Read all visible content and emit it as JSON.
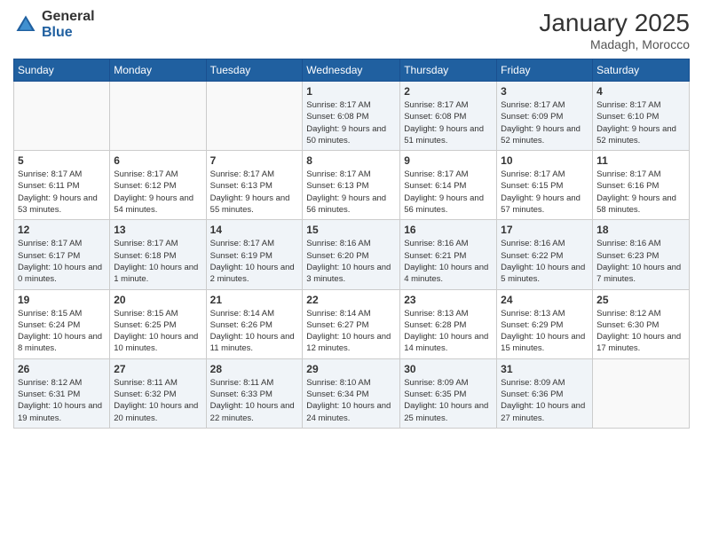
{
  "header": {
    "logo_general": "General",
    "logo_blue": "Blue",
    "month_year": "January 2025",
    "location": "Madagh, Morocco"
  },
  "days_of_week": [
    "Sunday",
    "Monday",
    "Tuesday",
    "Wednesday",
    "Thursday",
    "Friday",
    "Saturday"
  ],
  "weeks": [
    [
      {
        "day": "",
        "sunrise": "",
        "sunset": "",
        "daylight": ""
      },
      {
        "day": "",
        "sunrise": "",
        "sunset": "",
        "daylight": ""
      },
      {
        "day": "",
        "sunrise": "",
        "sunset": "",
        "daylight": ""
      },
      {
        "day": "1",
        "sunrise": "Sunrise: 8:17 AM",
        "sunset": "Sunset: 6:08 PM",
        "daylight": "Daylight: 9 hours and 50 minutes."
      },
      {
        "day": "2",
        "sunrise": "Sunrise: 8:17 AM",
        "sunset": "Sunset: 6:08 PM",
        "daylight": "Daylight: 9 hours and 51 minutes."
      },
      {
        "day": "3",
        "sunrise": "Sunrise: 8:17 AM",
        "sunset": "Sunset: 6:09 PM",
        "daylight": "Daylight: 9 hours and 52 minutes."
      },
      {
        "day": "4",
        "sunrise": "Sunrise: 8:17 AM",
        "sunset": "Sunset: 6:10 PM",
        "daylight": "Daylight: 9 hours and 52 minutes."
      }
    ],
    [
      {
        "day": "5",
        "sunrise": "Sunrise: 8:17 AM",
        "sunset": "Sunset: 6:11 PM",
        "daylight": "Daylight: 9 hours and 53 minutes."
      },
      {
        "day": "6",
        "sunrise": "Sunrise: 8:17 AM",
        "sunset": "Sunset: 6:12 PM",
        "daylight": "Daylight: 9 hours and 54 minutes."
      },
      {
        "day": "7",
        "sunrise": "Sunrise: 8:17 AM",
        "sunset": "Sunset: 6:13 PM",
        "daylight": "Daylight: 9 hours and 55 minutes."
      },
      {
        "day": "8",
        "sunrise": "Sunrise: 8:17 AM",
        "sunset": "Sunset: 6:13 PM",
        "daylight": "Daylight: 9 hours and 56 minutes."
      },
      {
        "day": "9",
        "sunrise": "Sunrise: 8:17 AM",
        "sunset": "Sunset: 6:14 PM",
        "daylight": "Daylight: 9 hours and 56 minutes."
      },
      {
        "day": "10",
        "sunrise": "Sunrise: 8:17 AM",
        "sunset": "Sunset: 6:15 PM",
        "daylight": "Daylight: 9 hours and 57 minutes."
      },
      {
        "day": "11",
        "sunrise": "Sunrise: 8:17 AM",
        "sunset": "Sunset: 6:16 PM",
        "daylight": "Daylight: 9 hours and 58 minutes."
      }
    ],
    [
      {
        "day": "12",
        "sunrise": "Sunrise: 8:17 AM",
        "sunset": "Sunset: 6:17 PM",
        "daylight": "Daylight: 10 hours and 0 minutes."
      },
      {
        "day": "13",
        "sunrise": "Sunrise: 8:17 AM",
        "sunset": "Sunset: 6:18 PM",
        "daylight": "Daylight: 10 hours and 1 minute."
      },
      {
        "day": "14",
        "sunrise": "Sunrise: 8:17 AM",
        "sunset": "Sunset: 6:19 PM",
        "daylight": "Daylight: 10 hours and 2 minutes."
      },
      {
        "day": "15",
        "sunrise": "Sunrise: 8:16 AM",
        "sunset": "Sunset: 6:20 PM",
        "daylight": "Daylight: 10 hours and 3 minutes."
      },
      {
        "day": "16",
        "sunrise": "Sunrise: 8:16 AM",
        "sunset": "Sunset: 6:21 PM",
        "daylight": "Daylight: 10 hours and 4 minutes."
      },
      {
        "day": "17",
        "sunrise": "Sunrise: 8:16 AM",
        "sunset": "Sunset: 6:22 PM",
        "daylight": "Daylight: 10 hours and 5 minutes."
      },
      {
        "day": "18",
        "sunrise": "Sunrise: 8:16 AM",
        "sunset": "Sunset: 6:23 PM",
        "daylight": "Daylight: 10 hours and 7 minutes."
      }
    ],
    [
      {
        "day": "19",
        "sunrise": "Sunrise: 8:15 AM",
        "sunset": "Sunset: 6:24 PM",
        "daylight": "Daylight: 10 hours and 8 minutes."
      },
      {
        "day": "20",
        "sunrise": "Sunrise: 8:15 AM",
        "sunset": "Sunset: 6:25 PM",
        "daylight": "Daylight: 10 hours and 10 minutes."
      },
      {
        "day": "21",
        "sunrise": "Sunrise: 8:14 AM",
        "sunset": "Sunset: 6:26 PM",
        "daylight": "Daylight: 10 hours and 11 minutes."
      },
      {
        "day": "22",
        "sunrise": "Sunrise: 8:14 AM",
        "sunset": "Sunset: 6:27 PM",
        "daylight": "Daylight: 10 hours and 12 minutes."
      },
      {
        "day": "23",
        "sunrise": "Sunrise: 8:13 AM",
        "sunset": "Sunset: 6:28 PM",
        "daylight": "Daylight: 10 hours and 14 minutes."
      },
      {
        "day": "24",
        "sunrise": "Sunrise: 8:13 AM",
        "sunset": "Sunset: 6:29 PM",
        "daylight": "Daylight: 10 hours and 15 minutes."
      },
      {
        "day": "25",
        "sunrise": "Sunrise: 8:12 AM",
        "sunset": "Sunset: 6:30 PM",
        "daylight": "Daylight: 10 hours and 17 minutes."
      }
    ],
    [
      {
        "day": "26",
        "sunrise": "Sunrise: 8:12 AM",
        "sunset": "Sunset: 6:31 PM",
        "daylight": "Daylight: 10 hours and 19 minutes."
      },
      {
        "day": "27",
        "sunrise": "Sunrise: 8:11 AM",
        "sunset": "Sunset: 6:32 PM",
        "daylight": "Daylight: 10 hours and 20 minutes."
      },
      {
        "day": "28",
        "sunrise": "Sunrise: 8:11 AM",
        "sunset": "Sunset: 6:33 PM",
        "daylight": "Daylight: 10 hours and 22 minutes."
      },
      {
        "day": "29",
        "sunrise": "Sunrise: 8:10 AM",
        "sunset": "Sunset: 6:34 PM",
        "daylight": "Daylight: 10 hours and 24 minutes."
      },
      {
        "day": "30",
        "sunrise": "Sunrise: 8:09 AM",
        "sunset": "Sunset: 6:35 PM",
        "daylight": "Daylight: 10 hours and 25 minutes."
      },
      {
        "day": "31",
        "sunrise": "Sunrise: 8:09 AM",
        "sunset": "Sunset: 6:36 PM",
        "daylight": "Daylight: 10 hours and 27 minutes."
      },
      {
        "day": "",
        "sunrise": "",
        "sunset": "",
        "daylight": ""
      }
    ]
  ]
}
